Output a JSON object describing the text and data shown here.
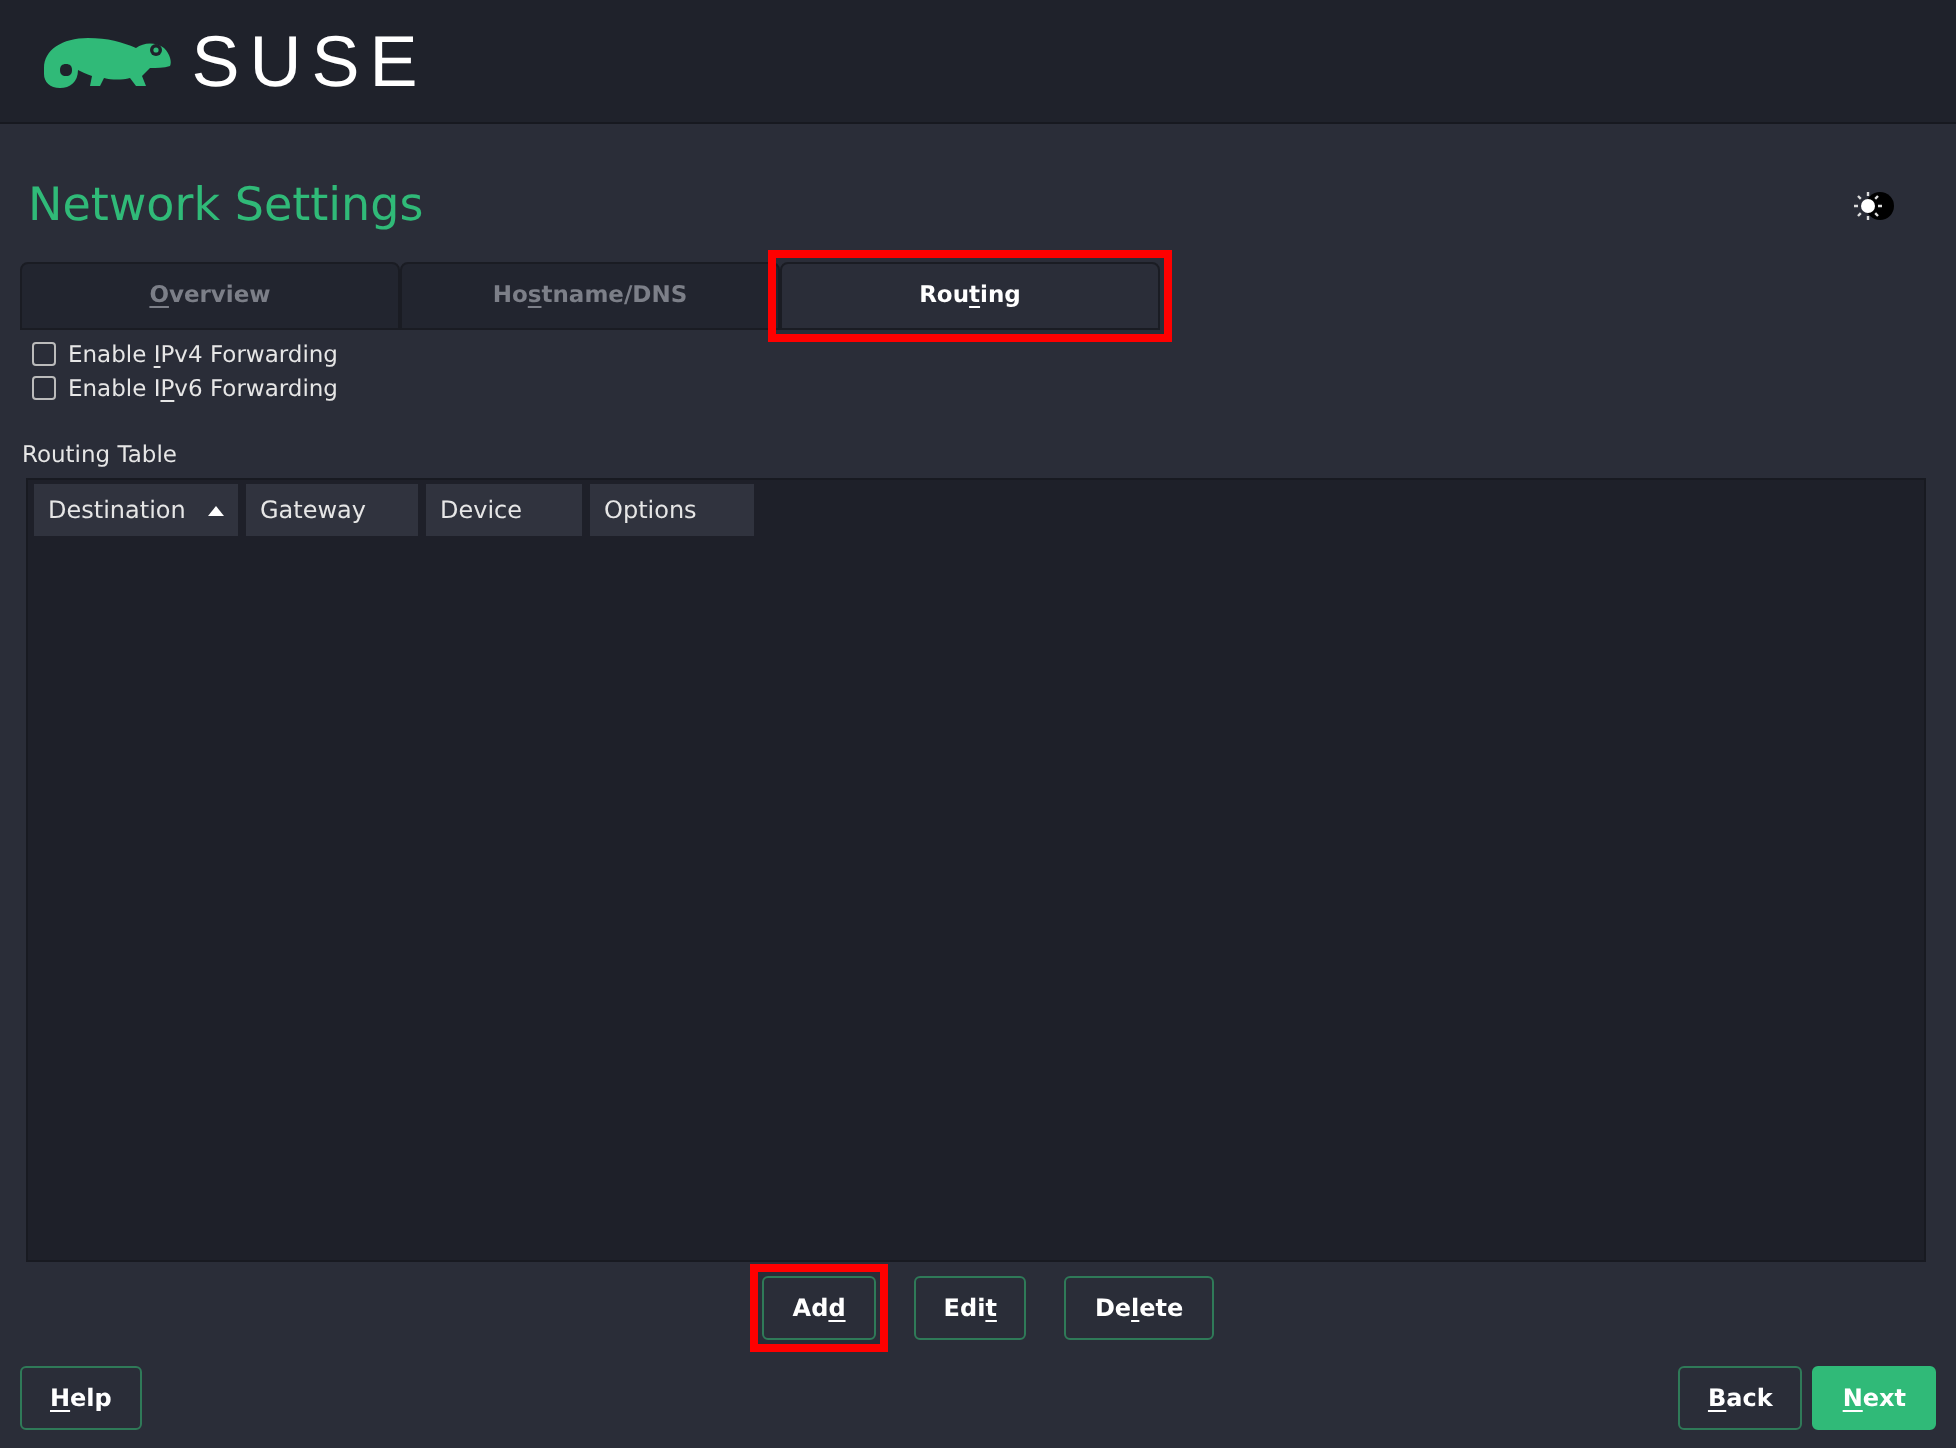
{
  "header": {
    "brand": "SUSE"
  },
  "page": {
    "title": "Network Settings"
  },
  "tabs": [
    {
      "label": {
        "key": "O",
        "post": "verview"
      },
      "selected": false,
      "highlighted": false
    },
    {
      "label": {
        "pre": "Ho",
        "key": "s",
        "post": "tname/DNS"
      },
      "selected": false,
      "highlighted": false
    },
    {
      "label": {
        "pre": "Rou",
        "key": "t",
        "post": "ing"
      },
      "selected": true,
      "highlighted": true
    }
  ],
  "checkboxes": [
    {
      "label": {
        "pre": "Enable ",
        "key": "I",
        "post": "Pv4 Forwarding"
      },
      "checked": false
    },
    {
      "label": {
        "pre": "Enable I",
        "key": "P",
        "post": "v6 Forwarding"
      },
      "checked": false
    }
  ],
  "table": {
    "label": "Routing Table",
    "columns": [
      {
        "label": "Destination",
        "sorted": true
      },
      {
        "label": "Gateway",
        "sorted": false
      },
      {
        "label": "Device",
        "sorted": false
      },
      {
        "label": "Options",
        "sorted": false
      }
    ]
  },
  "table_buttons": [
    {
      "label": {
        "pre": "Ad",
        "key": "d"
      },
      "highlighted": true
    },
    {
      "label": {
        "pre": "Edi",
        "key": "t"
      },
      "highlighted": false
    },
    {
      "label": {
        "pre": "De",
        "key": "l",
        "post": "ete"
      },
      "highlighted": false
    }
  ],
  "footer": {
    "left": [
      {
        "label": {
          "key": "H",
          "post": "elp"
        },
        "primary": false
      }
    ],
    "right": [
      {
        "label": {
          "key": "B",
          "post": "ack"
        },
        "primary": false
      },
      {
        "label": {
          "key": "N",
          "post": "ext"
        },
        "primary": true
      }
    ]
  }
}
